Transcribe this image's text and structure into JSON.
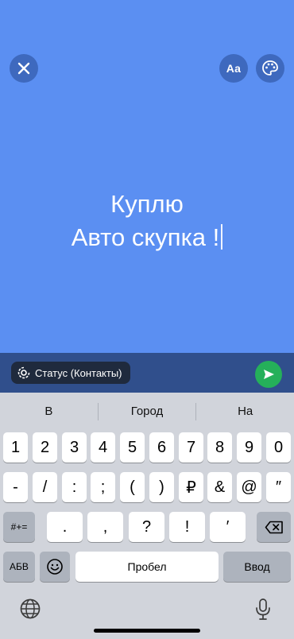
{
  "editor": {
    "status_lines": [
      "Куплю",
      "Авто скупка !"
    ],
    "background_color": "#5b8ff2",
    "font_button_label": "Aa",
    "close_icon": "close-icon",
    "palette_icon": "palette-icon"
  },
  "bottom_bar": {
    "privacy_label": "Статус (Контакты)",
    "privacy_icon": "privacy-ring-icon",
    "send_icon": "send-icon"
  },
  "keyboard": {
    "suggestions": [
      "В",
      "Город",
      "На"
    ],
    "row1": [
      "1",
      "2",
      "3",
      "4",
      "5",
      "6",
      "7",
      "8",
      "9",
      "0"
    ],
    "row2": [
      "-",
      "/",
      ":",
      ";",
      "(",
      ")",
      "₽",
      "&",
      "@",
      "″"
    ],
    "row3_left": "#+=",
    "row3": [
      ".",
      ",",
      "?",
      "!",
      "′"
    ],
    "row3_right_icon": "backspace-icon",
    "row4": {
      "lang": "АБВ",
      "emoji_icon": "emoji-icon",
      "space": "Пробел",
      "enter": "Ввод"
    },
    "globe_icon": "globe-icon",
    "mic_icon": "mic-icon"
  }
}
